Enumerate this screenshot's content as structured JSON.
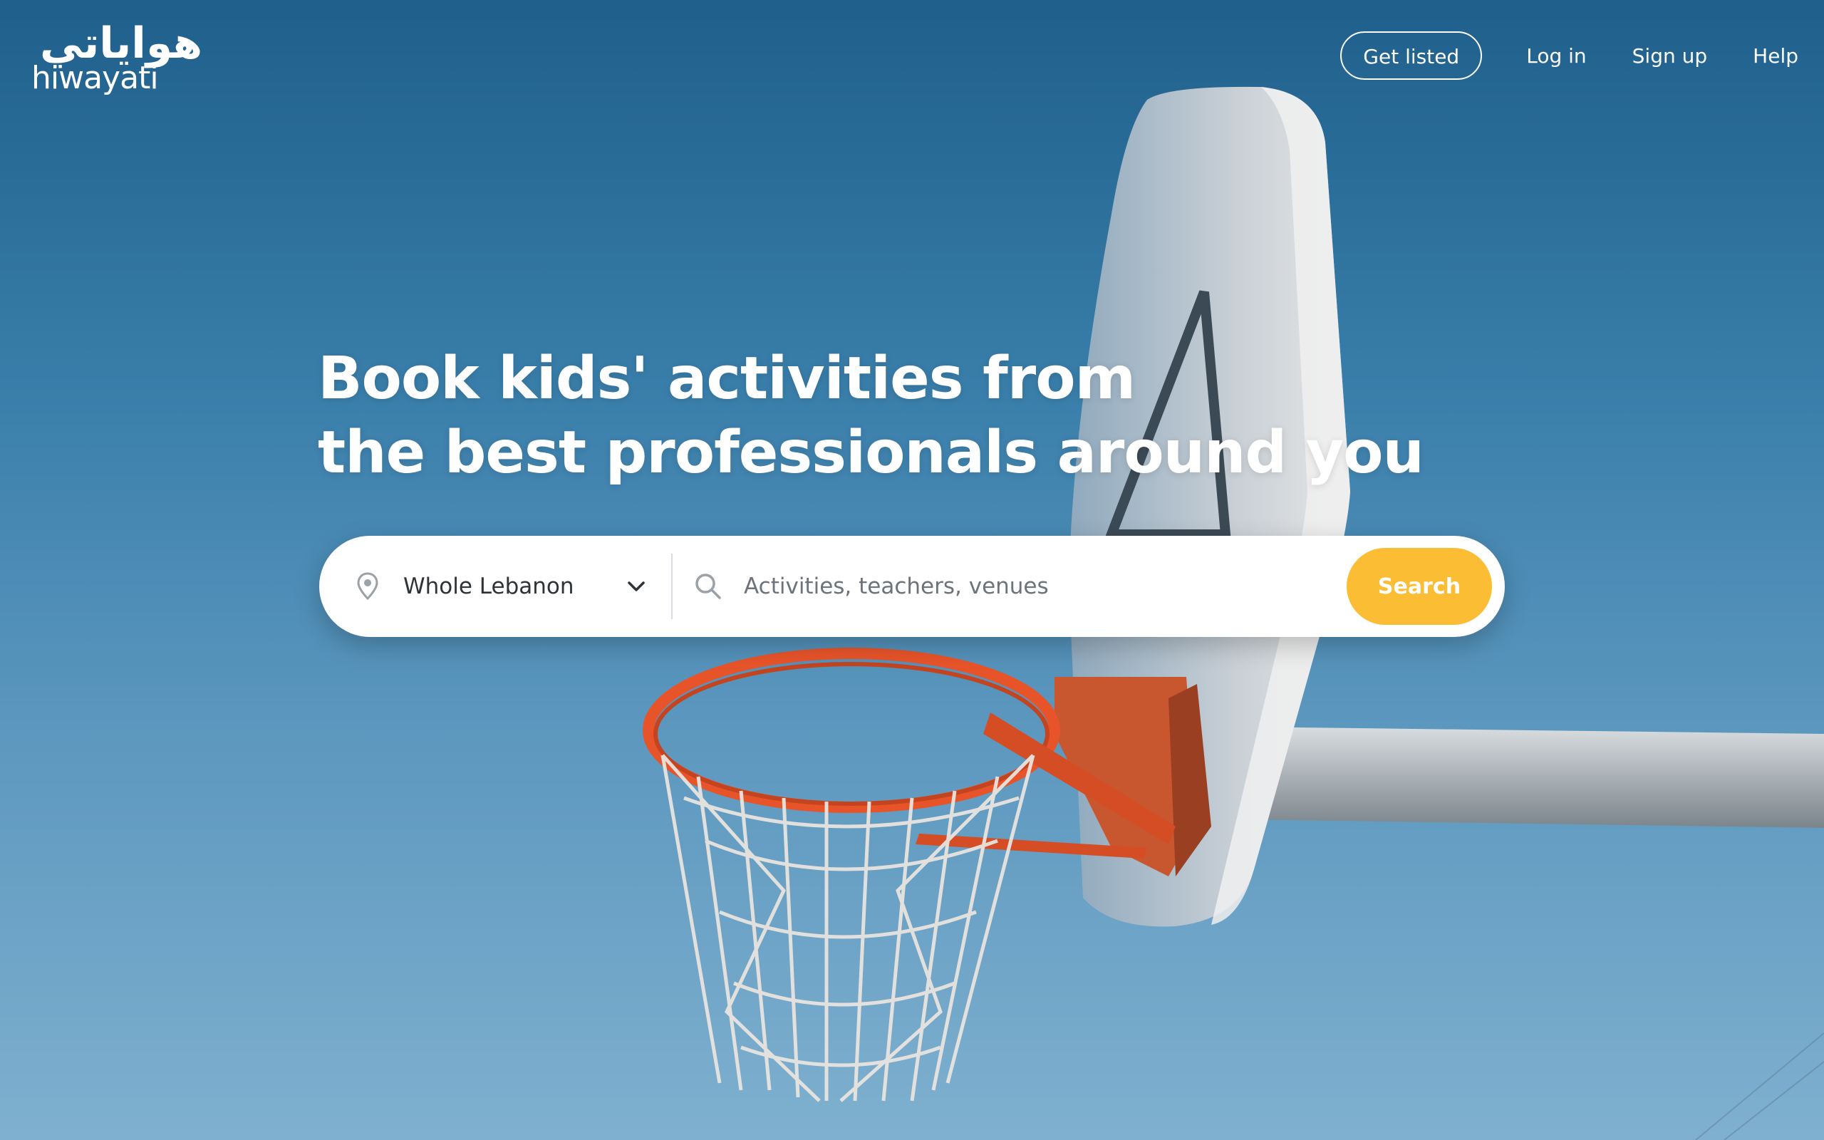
{
  "brand": {
    "arabic": "هواياتي",
    "latin": "hiwayati"
  },
  "nav": {
    "get_listed": "Get listed",
    "log_in": "Log in",
    "sign_up": "Sign up",
    "help": "Help"
  },
  "hero": {
    "line1": "Book kids' activities from",
    "line2": "the best professionals around you"
  },
  "search": {
    "location_value": "Whole Lebanon",
    "query_placeholder": "Activities, teachers, venues",
    "button_label": "Search"
  },
  "colors": {
    "accent": "#fbbd33",
    "sky_top": "#1f5f8b",
    "sky_bottom": "#7fb0cf",
    "rim": "#e8542a"
  },
  "icons": {
    "location": "map-pin-icon",
    "dropdown": "chevron-down-icon",
    "search": "search-icon"
  }
}
